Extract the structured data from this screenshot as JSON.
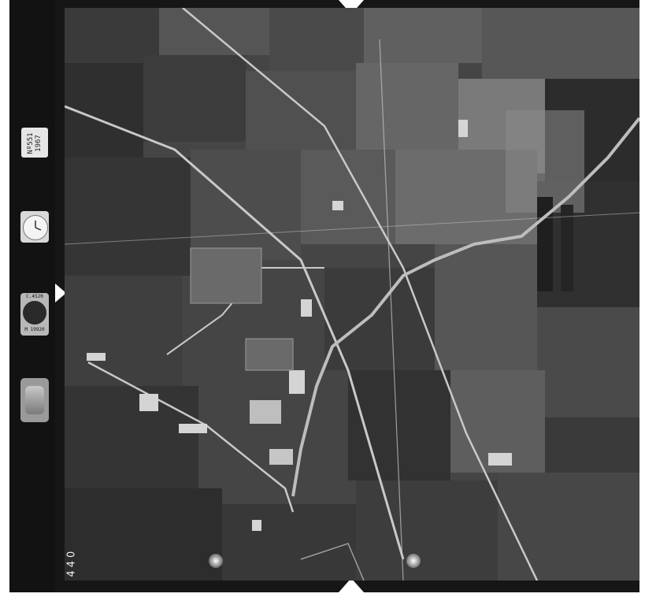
{
  "image": {
    "kind": "aerial survey photograph",
    "tones": {
      "background": "#ffffff",
      "film_border": "#161616",
      "fields_dark": "#2e2e2e",
      "fields_mid": "#555555",
      "fields_light": "#8a8a8a",
      "roads": "#c9c9c9",
      "river": "#bfbfbf"
    }
  },
  "instruments": {
    "counter_text": "Nº551 1967",
    "altimeter_top": "C.4520",
    "altimeter_bottom": "M 19920",
    "frame_number": "440"
  }
}
